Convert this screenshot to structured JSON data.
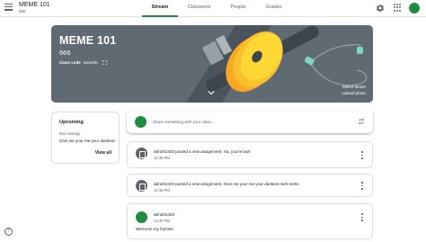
{
  "header": {
    "class_title": "MEME 101",
    "class_section": "666",
    "tabs": [
      {
        "label": "Stream",
        "active": true
      },
      {
        "label": "Classwork",
        "active": false
      },
      {
        "label": "People",
        "active": false
      },
      {
        "label": "Grades",
        "active": false
      }
    ],
    "icons": [
      "menu-icon",
      "gear-icon",
      "apps-icon",
      "avatar"
    ]
  },
  "banner": {
    "title": "MEME 101",
    "section": "666",
    "class_code_label": "Class code",
    "class_code": "tsxnehb",
    "select_theme": "Select theme",
    "upload_photo": "Upload photo",
    "colors": {
      "background": "#5f6a73",
      "accent": "#fbc02d",
      "cable": "#7fd4c4"
    }
  },
  "upcoming": {
    "title": "Upcoming",
    "due": "Due Sunday",
    "item": "Give me your me your dankest meh-mehs",
    "view_all": "View all"
  },
  "share": {
    "placeholder": "Share something with your class..."
  },
  "posts": [
    {
      "type": "assignment",
      "text": "wilroth2403 posted a new assignment: Ha, you're last!",
      "time": "12:46 PM"
    },
    {
      "type": "assignment",
      "text": "wilroth2403 posted a new assignment: Give me your me your dankest meh-mehs",
      "time": "12:43 PM"
    },
    {
      "type": "announcement",
      "author": "wilroth2403",
      "time": "12:40 PM",
      "body": "Welcome my homies"
    }
  ],
  "colors": {
    "accent": "#1e8e3e",
    "text": "#202124",
    "muted": "#5f6368"
  }
}
